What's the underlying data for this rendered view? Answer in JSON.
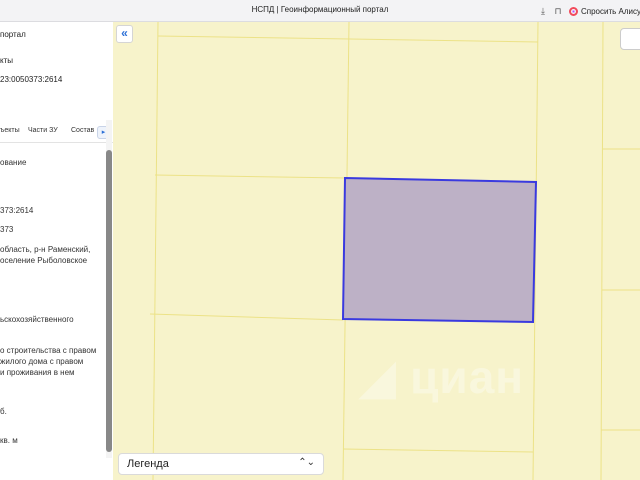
{
  "browser": {
    "title": "НСПД | Геоинформационный портал",
    "alisa_label": "Спросить Алису А"
  },
  "panel": {
    "portal_text": "портал",
    "objects_text": "кты",
    "cadastral_number": "23:0050373:2614",
    "tabs": [
      "ъекты",
      "Части ЗУ",
      "Состав"
    ],
    "fields": [
      "ование",
      "373:2614",
      "373",
      "область, р-н Раменский,",
      "оселение Рыболовское",
      "ьскохозяйственного",
      "о строительства с правом",
      "жилого дома с правом",
      "и проживания в нем",
      "б.",
      "кв. м"
    ]
  },
  "map": {
    "legend_label": "Легенда",
    "watermark": "циан",
    "colors": {
      "background": "#f7f3cb",
      "parcel_lines": "#ece287",
      "selected_fill": "#bdb1c6",
      "selected_stroke": "#3a3adf"
    }
  }
}
